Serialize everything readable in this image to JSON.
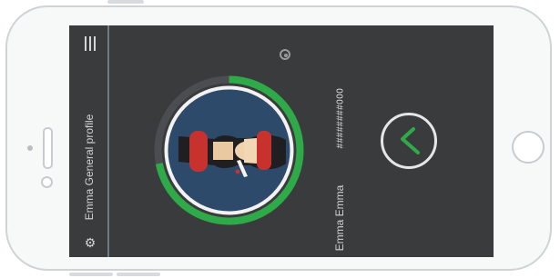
{
  "app": {
    "title": "Emma General profile"
  },
  "profile": {
    "name": "Emma Emma",
    "id_text": "########000",
    "progress": 0.72
  },
  "icons": {
    "menu": "hamburger-icon",
    "settings": "gear-icon",
    "edit": "edit-dot-icon",
    "confirm": "check-icon"
  },
  "colors": {
    "screen_bg": "#3a3b3d",
    "progress_ring": "#2eaa49",
    "avatar_bg": "#2d4a6b",
    "check": "#2eaa49"
  }
}
